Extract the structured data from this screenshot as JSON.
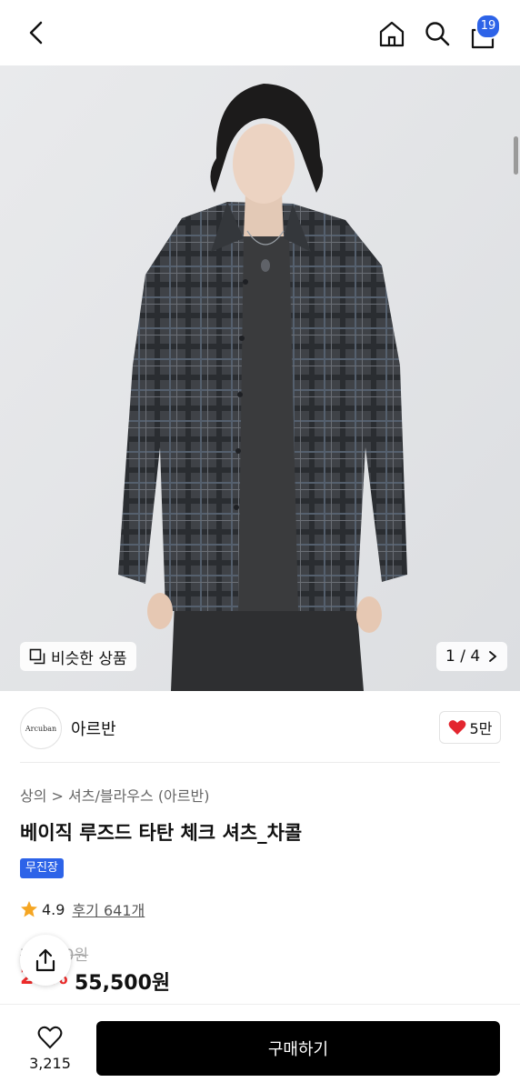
{
  "header": {
    "back_icon": "chevron-left-icon",
    "home_icon": "home-icon",
    "search_icon": "search-icon",
    "cart_icon": "shopping-bag-icon",
    "cart_count": "19"
  },
  "gallery": {
    "similar_label": "비슷한 상품",
    "page_indicator": "1 / 4"
  },
  "brand": {
    "logo_text": "Arcuban",
    "name": "아르반",
    "likes": "5만"
  },
  "product": {
    "breadcrumb": "상의 > 셔츠/블라우스 (아르반)",
    "title": "베이직 루즈드 타탄 체크 셔츠_차콜",
    "tag": "무진장",
    "rating": "4.9",
    "reviews": "후기 641개",
    "original_price": "74,000원",
    "discount": "25%",
    "price": "55,500원"
  },
  "bottom": {
    "wish_count": "3,215",
    "buy_label": "구매하기"
  },
  "colors": {
    "accent": "#2d63e8",
    "discount": "#ef2b2a",
    "star": "#f5a623",
    "heart": "#e3262f"
  }
}
